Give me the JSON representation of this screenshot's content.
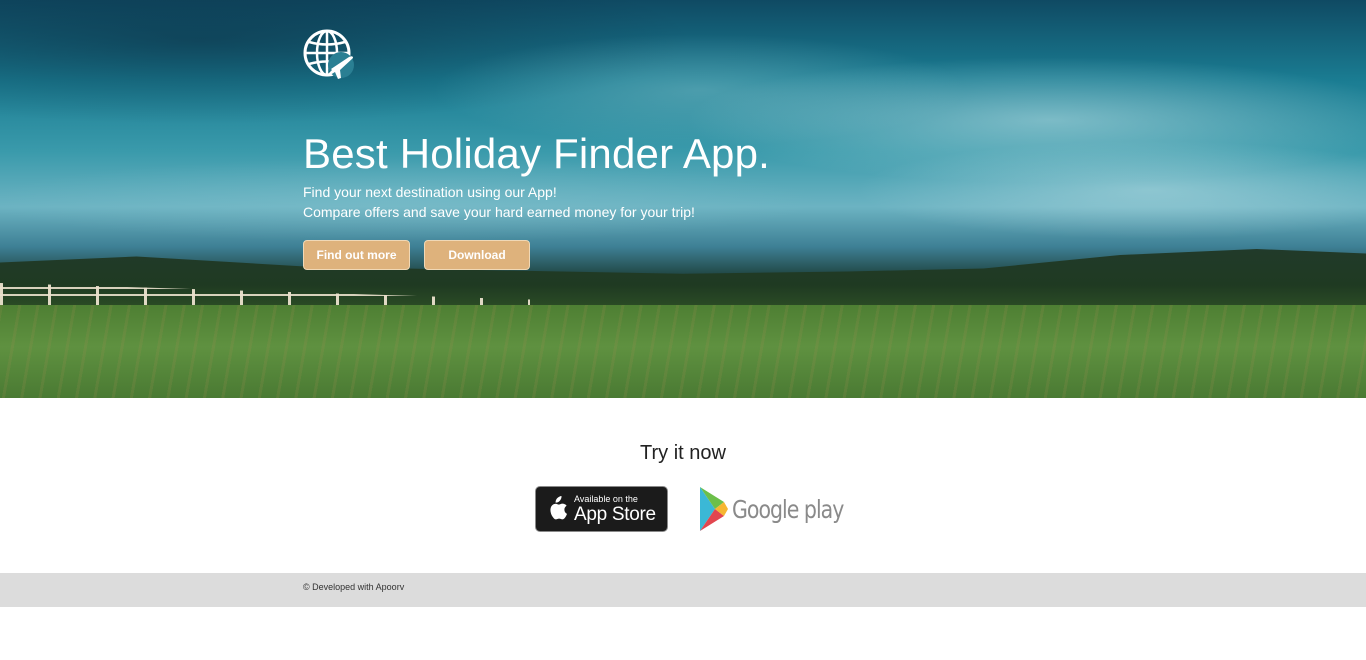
{
  "hero": {
    "title": "Best Holiday Finder App.",
    "subtitle_line1": "Find your next destination using our App!",
    "subtitle_line2": "Compare offers and save your hard earned money for your trip!",
    "buttons": {
      "find_out_more": "Find out more",
      "download": "Download"
    },
    "logo_icon": "globe-plane-icon"
  },
  "try_section": {
    "heading": "Try it now",
    "app_store": {
      "small_text": "Available on the",
      "big_text": "App Store",
      "icon": "apple-icon"
    },
    "google_play": {
      "text": "Google play",
      "icon": "play-triangle-icon"
    }
  },
  "footer": {
    "text": "© Developed with Apoorv"
  },
  "colors": {
    "button_bg": "#deb27c",
    "footer_bg": "#dcdcdc"
  }
}
